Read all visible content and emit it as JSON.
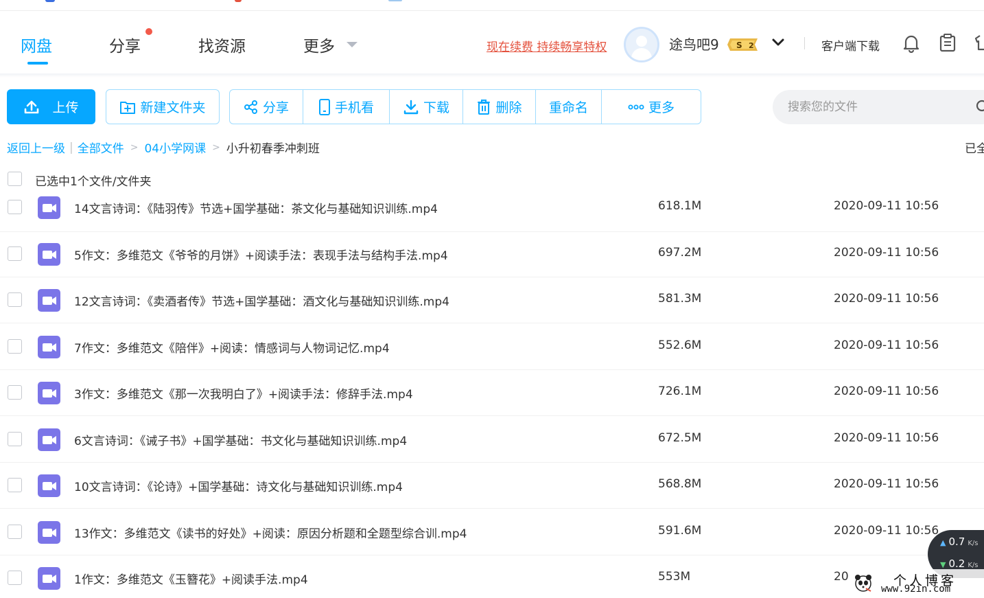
{
  "colors": {
    "accent": "#06a7ff",
    "renew": "#e4523e",
    "video_icon": "#7b75e8",
    "notification_dot": "#f25a4a"
  },
  "nav": {
    "items": [
      {
        "label": "网盘",
        "active": true
      },
      {
        "label": "分享",
        "active": false,
        "has_dot": true
      },
      {
        "label": "找资源",
        "active": false
      },
      {
        "label": "更多",
        "active": false,
        "has_caret": true
      }
    ]
  },
  "header": {
    "renew_link": "现在续费 持续畅享特权",
    "username": "途鸟吧9",
    "vip_badge": "2",
    "vip_badge_prefix": "S",
    "client_download": "客户端下载",
    "icons": [
      "bell-icon",
      "clipboard-icon"
    ]
  },
  "toolbar": {
    "upload_label": "上传",
    "new_folder_label": "新建文件夹",
    "actions": [
      {
        "label": "分享",
        "icon": "share-icon"
      },
      {
        "label": "手机看",
        "icon": "phone-icon"
      },
      {
        "label": "下载",
        "icon": "download-icon"
      },
      {
        "label": "删除",
        "icon": "trash-icon"
      },
      {
        "label": "重命名",
        "icon": ""
      },
      {
        "label": "更多",
        "icon": "more-dots-icon"
      }
    ]
  },
  "search": {
    "placeholder": "搜索您的文件",
    "value": ""
  },
  "breadcrumb": {
    "back": "返回上一级",
    "separator": "|",
    "items": [
      "全部文件",
      "04小学网课"
    ],
    "arrow": ">",
    "current": "小升初春季冲刺班"
  },
  "loaded_text": "已全",
  "selection": {
    "text": "已选中1个文件/文件夹"
  },
  "files": [
    {
      "name": "14文言诗词：《陆羽传》节选+国学基础：茶文化与基础知识训练.mp4",
      "size": "618.1M",
      "date": "2020-09-11 10:56"
    },
    {
      "name": "5作文：多维范文《爷爷的月饼》+阅读手法：表现手法与结构手法.mp4",
      "size": "697.2M",
      "date": "2020-09-11 10:56"
    },
    {
      "name": "12文言诗词：《卖酒者传》节选+国学基础：酒文化与基础知识训练.mp4",
      "size": "581.3M",
      "date": "2020-09-11 10:56"
    },
    {
      "name": "7作文：多维范文《陪伴》+阅读：情感词与人物词记忆.mp4",
      "size": "552.6M",
      "date": "2020-09-11 10:56"
    },
    {
      "name": "3作文：多维范文《那一次我明白了》+阅读手法：修辞手法.mp4",
      "size": "726.1M",
      "date": "2020-09-11 10:56"
    },
    {
      "name": "6文言诗词：《诫子书》+国学基础：书文化与基础知识训练.mp4",
      "size": "672.5M",
      "date": "2020-09-11 10:56"
    },
    {
      "name": "10文言诗词：《论诗》+国学基础：诗文化与基础知识训练.mp4",
      "size": "568.8M",
      "date": "2020-09-11 10:56"
    },
    {
      "name": "13作文：多维范文《读书的好处》+阅读：原因分析题和全题型综合训.mp4",
      "size": "591.6M",
      "date": "2020-09-11 10:56"
    },
    {
      "name": "1作文：多维范文《玉簪花》+阅读手法.mp4",
      "size": "553M",
      "date": "20"
    }
  ],
  "speed_widget": {
    "up": "0.7",
    "up_unit": "K/s",
    "down": "0.2",
    "down_unit": "K/s"
  },
  "watermark": {
    "title": "个人博客",
    "url": "www.92in.com"
  }
}
